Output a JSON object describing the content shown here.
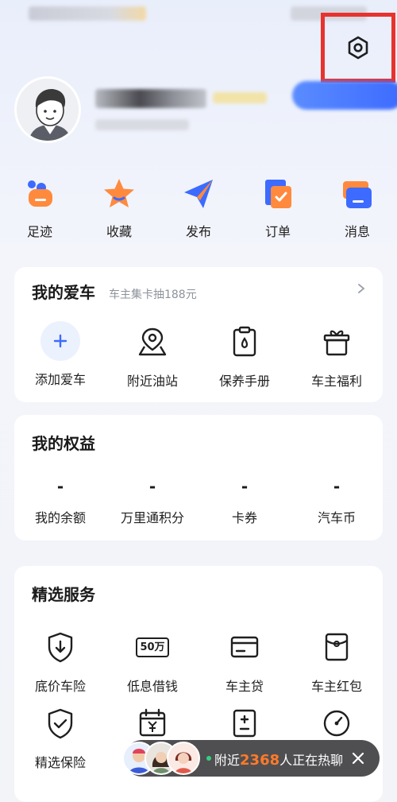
{
  "colors": {
    "accent": "#3d6bff",
    "highlight_box": "#e8322d",
    "float_number": "#ff7a29"
  },
  "header": {
    "settings_icon": "settings-hexagon-icon"
  },
  "quick_actions": [
    {
      "label": "足迹",
      "icon": "footprint-icon"
    },
    {
      "label": "收藏",
      "icon": "star-icon"
    },
    {
      "label": "发布",
      "icon": "paper-plane-icon"
    },
    {
      "label": "订单",
      "icon": "order-icon"
    },
    {
      "label": "消息",
      "icon": "message-icon"
    }
  ],
  "my_car": {
    "title": "我的爱车",
    "subtitle": "车主集卡抽188元",
    "items": [
      {
        "label": "添加爱车",
        "icon": "plus-icon"
      },
      {
        "label": "附近油站",
        "icon": "map-pin-icon"
      },
      {
        "label": "保养手册",
        "icon": "clipboard-icon"
      },
      {
        "label": "车主福利",
        "icon": "gift-icon"
      }
    ]
  },
  "equity": {
    "title": "我的权益",
    "items": [
      {
        "value": "-",
        "label": "我的余额"
      },
      {
        "value": "-",
        "label": "万里通积分"
      },
      {
        "value": "-",
        "label": "卡券"
      },
      {
        "value": "-",
        "label": "汽车币"
      }
    ]
  },
  "services": {
    "title": "精选服务",
    "row1": [
      {
        "label": "底价车险",
        "icon": "shield-down-icon"
      },
      {
        "label": "低息借钱",
        "icon": "fifty-wan-icon",
        "icon_text": "50万"
      },
      {
        "label": "车主贷",
        "icon": "card-icon"
      },
      {
        "label": "车主红包",
        "icon": "red-packet-icon"
      }
    ],
    "row2": [
      {
        "label": "精选保险",
        "icon": "shield-check-icon"
      },
      {
        "label": "",
        "icon": "calendar-yen-icon"
      },
      {
        "label": "",
        "icon": "plus-minus-icon"
      },
      {
        "label": "",
        "icon": "gauge-icon"
      }
    ]
  },
  "floating_chat": {
    "prefix": "附近",
    "count": "2368",
    "suffix": "人正在热聊",
    "close_icon": "close-icon"
  }
}
